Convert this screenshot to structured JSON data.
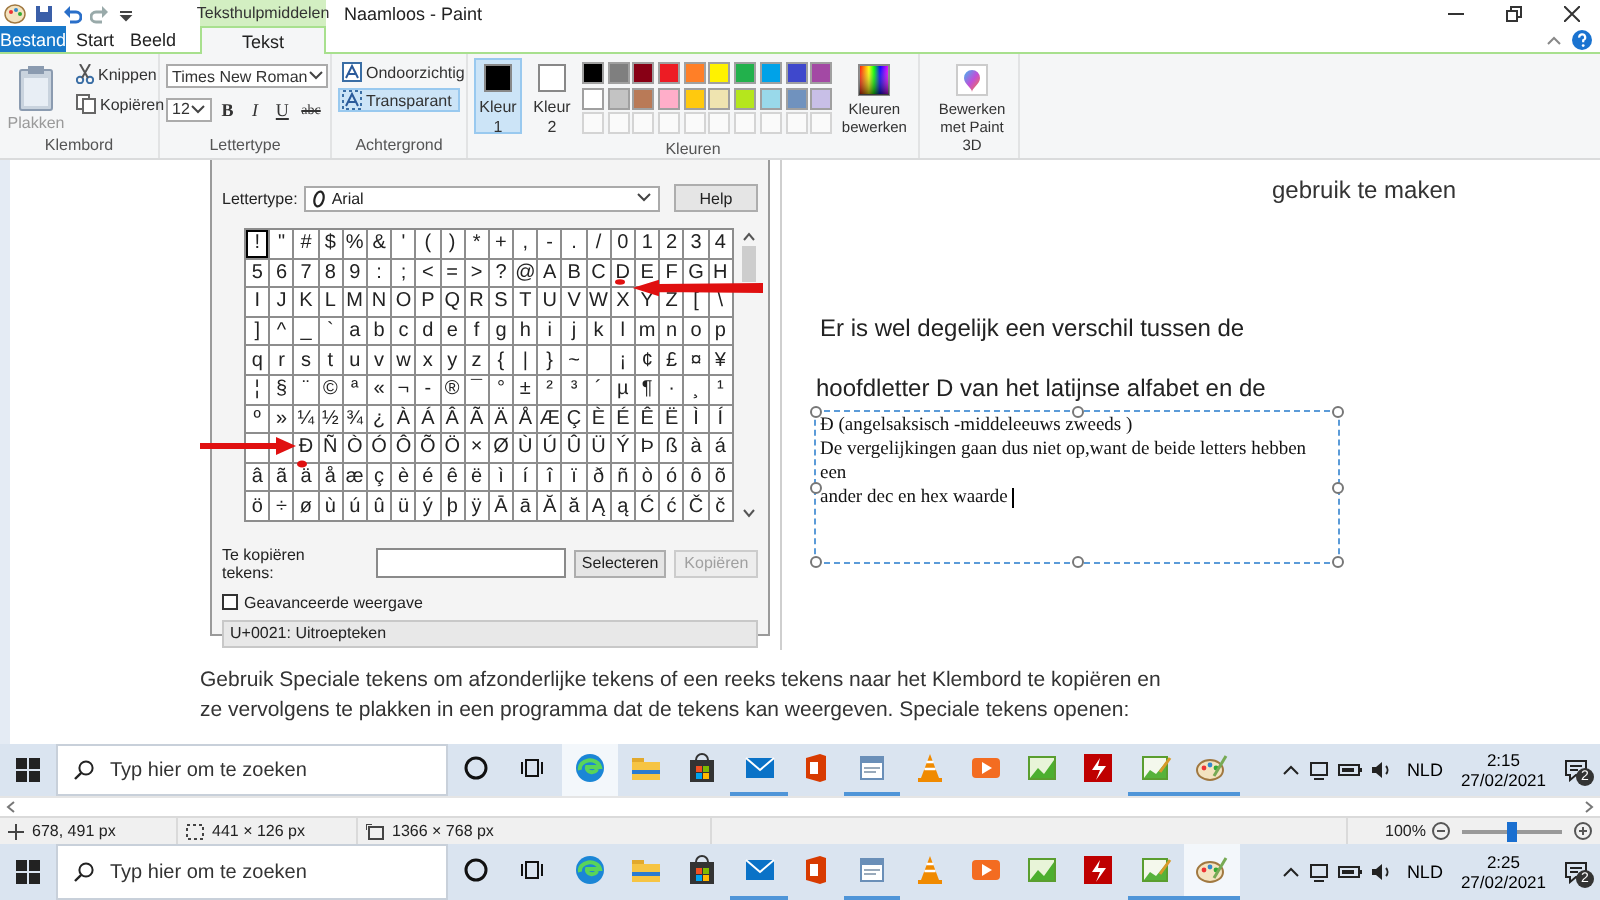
{
  "window": {
    "title": "Naamloos - Paint",
    "context_tab": "Teksthulpmiddelen"
  },
  "tabs": [
    {
      "label": "Bestand",
      "kind": "file",
      "selected": false
    },
    {
      "label": "Start",
      "kind": "tab",
      "selected": false
    },
    {
      "label": "Beeld",
      "kind": "tab",
      "selected": false
    },
    {
      "label": "Tekst",
      "kind": "tab",
      "selected": true
    }
  ],
  "ribbon": {
    "clipboard": {
      "label": "Klembord",
      "paste": {
        "label": "Plakken",
        "disabled": true
      },
      "cut": "Knippen",
      "copy": "Kopiëren"
    },
    "font": {
      "label": "Lettertype",
      "family": "Times New Roman",
      "size": "12",
      "styles": [
        {
          "label": "B",
          "kind": "bold"
        },
        {
          "label": "I",
          "kind": "italic"
        },
        {
          "label": "U",
          "kind": "underline"
        },
        {
          "label": "abc",
          "kind": "strike"
        }
      ]
    },
    "background": {
      "label": "Achtergrond",
      "options": [
        {
          "label": "Ondoorzichtig",
          "selected": false
        },
        {
          "label": "Transparant",
          "selected": true
        }
      ]
    },
    "colors": {
      "label": "Kleuren",
      "slots": [
        {
          "label": "Kleur 1",
          "color": "#000000",
          "selected": true
        },
        {
          "label": "Kleur 2",
          "color": "#ffffff",
          "selected": false
        }
      ],
      "palette": [
        {
          "color": "#000000"
        },
        {
          "color": "#7f7f7f"
        },
        {
          "color": "#880015"
        },
        {
          "color": "#ed1c24"
        },
        {
          "color": "#ff7f27"
        },
        {
          "color": "#fff200"
        },
        {
          "color": "#22b14c"
        },
        {
          "color": "#00a2e8"
        },
        {
          "color": "#3f48cc"
        },
        {
          "color": "#a349a4"
        },
        {
          "color": "#ffffff"
        },
        {
          "color": "#c3c3c3"
        },
        {
          "color": "#b97a57"
        },
        {
          "color": "#ffaec9"
        },
        {
          "color": "#ffc90e"
        },
        {
          "color": "#efe4b0"
        },
        {
          "color": "#b5e61d"
        },
        {
          "color": "#99d9ea"
        },
        {
          "color": "#7092be"
        },
        {
          "color": "#c8bfe7"
        }
      ],
      "edit": "Kleuren bewerken"
    },
    "paint3d": "Bewerken met Paint 3D"
  },
  "canvas": {
    "char_map": {
      "font_label": "Lettertype:",
      "font": "Arial",
      "help": "Help",
      "rows": [
        [
          {
            "char": "!",
            "selected": true
          },
          {
            "char": "\"",
            "selected": false
          },
          {
            "char": "#",
            "selected": false
          },
          {
            "char": "$",
            "selected": false
          },
          {
            "char": "%",
            "selected": false
          },
          {
            "char": "&",
            "selected": false
          },
          {
            "char": "'",
            "selected": false
          },
          {
            "char": "(",
            "selected": false
          },
          {
            "char": ")",
            "selected": false
          },
          {
            "char": "*",
            "selected": false
          },
          {
            "char": "+",
            "selected": false
          },
          {
            "char": ",",
            "selected": false
          },
          {
            "char": "-",
            "selected": false
          },
          {
            "char": ".",
            "selected": false
          },
          {
            "char": "/",
            "selected": false
          },
          {
            "char": "0",
            "selected": false
          },
          {
            "char": "1",
            "selected": false
          },
          {
            "char": "2",
            "selected": false
          },
          {
            "char": "3",
            "selected": false
          },
          {
            "char": "4",
            "selected": false
          }
        ],
        [
          {
            "char": "5",
            "selected": false
          },
          {
            "char": "6",
            "selected": false
          },
          {
            "char": "7",
            "selected": false
          },
          {
            "char": "8",
            "selected": false
          },
          {
            "char": "9",
            "selected": false
          },
          {
            "char": ":",
            "selected": false
          },
          {
            "char": ";",
            "selected": false
          },
          {
            "char": "<",
            "selected": false
          },
          {
            "char": "=",
            "selected": false
          },
          {
            "char": ">",
            "selected": false
          },
          {
            "char": "?",
            "selected": false
          },
          {
            "char": "@",
            "selected": false
          },
          {
            "char": "A",
            "selected": false
          },
          {
            "char": "B",
            "selected": false
          },
          {
            "char": "C",
            "selected": false
          },
          {
            "char": "D",
            "selected": false
          },
          {
            "char": "E",
            "selected": false
          },
          {
            "char": "F",
            "selected": false
          },
          {
            "char": "G",
            "selected": false
          },
          {
            "char": "H",
            "selected": false
          }
        ],
        [
          {
            "char": "I",
            "selected": false
          },
          {
            "char": "J",
            "selected": false
          },
          {
            "char": "K",
            "selected": false
          },
          {
            "char": "L",
            "selected": false
          },
          {
            "char": "M",
            "selected": false
          },
          {
            "char": "N",
            "selected": false
          },
          {
            "char": "O",
            "selected": false
          },
          {
            "char": "P",
            "selected": false
          },
          {
            "char": "Q",
            "selected": false
          },
          {
            "char": "R",
            "selected": false
          },
          {
            "char": "S",
            "selected": false
          },
          {
            "char": "T",
            "selected": false
          },
          {
            "char": "U",
            "selected": false
          },
          {
            "char": "V",
            "selected": false
          },
          {
            "char": "W",
            "selected": false
          },
          {
            "char": "X",
            "selected": false
          },
          {
            "char": "Y",
            "selected": false
          },
          {
            "char": "Z",
            "selected": false
          },
          {
            "char": "[",
            "selected": false
          },
          {
            "char": "\\",
            "selected": false
          }
        ],
        [
          {
            "char": "]",
            "selected": false
          },
          {
            "char": "^",
            "selected": false
          },
          {
            "char": "_",
            "selected": false
          },
          {
            "char": "`",
            "selected": false
          },
          {
            "char": "a",
            "selected": false
          },
          {
            "char": "b",
            "selected": false
          },
          {
            "char": "c",
            "selected": false
          },
          {
            "char": "d",
            "selected": false
          },
          {
            "char": "e",
            "selected": false
          },
          {
            "char": "f",
            "selected": false
          },
          {
            "char": "g",
            "selected": false
          },
          {
            "char": "h",
            "selected": false
          },
          {
            "char": "i",
            "selected": false
          },
          {
            "char": "j",
            "selected": false
          },
          {
            "char": "k",
            "selected": false
          },
          {
            "char": "l",
            "selected": false
          },
          {
            "char": "m",
            "selected": false
          },
          {
            "char": "n",
            "selected": false
          },
          {
            "char": "o",
            "selected": false
          },
          {
            "char": "p",
            "selected": false
          }
        ],
        [
          {
            "char": "q",
            "selected": false
          },
          {
            "char": "r",
            "selected": false
          },
          {
            "char": "s",
            "selected": false
          },
          {
            "char": "t",
            "selected": false
          },
          {
            "char": "u",
            "selected": false
          },
          {
            "char": "v",
            "selected": false
          },
          {
            "char": "w",
            "selected": false
          },
          {
            "char": "x",
            "selected": false
          },
          {
            "char": "y",
            "selected": false
          },
          {
            "char": "z",
            "selected": false
          },
          {
            "char": "{",
            "selected": false
          },
          {
            "char": "|",
            "selected": false
          },
          {
            "char": "}",
            "selected": false
          },
          {
            "char": "~",
            "selected": false
          },
          {
            "selected": false
          },
          {
            "char": "¡",
            "selected": false
          },
          {
            "char": "¢",
            "selected": false
          },
          {
            "char": "£",
            "selected": false
          },
          {
            "char": "¤",
            "selected": false
          },
          {
            "char": "¥",
            "selected": false
          }
        ],
        [
          {
            "char": "¦",
            "selected": false
          },
          {
            "char": "§",
            "selected": false
          },
          {
            "char": "¨",
            "selected": false
          },
          {
            "char": "©",
            "selected": false
          },
          {
            "char": "ª",
            "selected": false
          },
          {
            "char": "«",
            "selected": false
          },
          {
            "char": "¬",
            "selected": false
          },
          {
            "char": "-",
            "selected": false
          },
          {
            "char": "®",
            "selected": false
          },
          {
            "char": "¯",
            "selected": false
          },
          {
            "char": "°",
            "selected": false
          },
          {
            "char": "±",
            "selected": false
          },
          {
            "char": "²",
            "selected": false
          },
          {
            "char": "³",
            "selected": false
          },
          {
            "char": "´",
            "selected": false
          },
          {
            "char": "µ",
            "selected": false
          },
          {
            "char": "¶",
            "selected": false
          },
          {
            "char": "·",
            "selected": false
          },
          {
            "char": "¸",
            "selected": false
          },
          {
            "char": "¹",
            "selected": false
          }
        ],
        [
          {
            "char": "º",
            "selected": false
          },
          {
            "char": "»",
            "selected": false
          },
          {
            "char": "¼",
            "selected": false
          },
          {
            "char": "½",
            "selected": false
          },
          {
            "char": "¾",
            "selected": false
          },
          {
            "char": "¿",
            "selected": false
          },
          {
            "char": "À",
            "selected": false
          },
          {
            "char": "Á",
            "selected": false
          },
          {
            "char": "Â",
            "selected": false
          },
          {
            "char": "Ã",
            "selected": false
          },
          {
            "char": "Ä",
            "selected": false
          },
          {
            "char": "Å",
            "selected": false
          },
          {
            "char": "Æ",
            "selected": false
          },
          {
            "char": "Ç",
            "selected": false
          },
          {
            "char": "È",
            "selected": false
          },
          {
            "char": "É",
            "selected": false
          },
          {
            "char": "Ê",
            "selected": false
          },
          {
            "char": "Ë",
            "selected": false
          },
          {
            "char": "Ì",
            "selected": false
          },
          {
            "char": "Í",
            "selected": false
          }
        ],
        [
          {
            "selected": false
          },
          {
            "selected": false
          },
          {
            "char": "Ð",
            "selected": false
          },
          {
            "char": "Ñ",
            "selected": false
          },
          {
            "char": "Ò",
            "selected": false
          },
          {
            "char": "Ó",
            "selected": false
          },
          {
            "char": "Ô",
            "selected": false
          },
          {
            "char": "Õ",
            "selected": false
          },
          {
            "char": "Ö",
            "selected": false
          },
          {
            "char": "×",
            "selected": false
          },
          {
            "char": "Ø",
            "selected": false
          },
          {
            "char": "Ù",
            "selected": false
          },
          {
            "char": "Ú",
            "selected": false
          },
          {
            "char": "Û",
            "selected": false
          },
          {
            "char": "Ü",
            "selected": false
          },
          {
            "char": "Ý",
            "selected": false
          },
          {
            "char": "Þ",
            "selected": false
          },
          {
            "char": "ß",
            "selected": false
          },
          {
            "char": "à",
            "selected": false
          },
          {
            "char": "á",
            "selected": false
          }
        ],
        [
          {
            "char": "â",
            "selected": false
          },
          {
            "char": "ã",
            "selected": false
          },
          {
            "char": "ä",
            "selected": false
          },
          {
            "char": "å",
            "selected": false
          },
          {
            "char": "æ",
            "selected": false
          },
          {
            "char": "ç",
            "selected": false
          },
          {
            "char": "è",
            "selected": false
          },
          {
            "char": "é",
            "selected": false
          },
          {
            "char": "ê",
            "selected": false
          },
          {
            "char": "ë",
            "selected": false
          },
          {
            "char": "ì",
            "selected": false
          },
          {
            "char": "í",
            "selected": false
          },
          {
            "char": "î",
            "selected": false
          },
          {
            "char": "ï",
            "selected": false
          },
          {
            "char": "ð",
            "selected": false
          },
          {
            "char": "ñ",
            "selected": false
          },
          {
            "char": "ò",
            "selected": false
          },
          {
            "char": "ó",
            "selected": false
          },
          {
            "char": "ô",
            "selected": false
          },
          {
            "char": "õ",
            "selected": false
          }
        ],
        [
          {
            "char": "ö",
            "selected": false
          },
          {
            "char": "÷",
            "selected": false
          },
          {
            "char": "ø",
            "selected": false
          },
          {
            "char": "ù",
            "selected": false
          },
          {
            "char": "ú",
            "selected": false
          },
          {
            "char": "û",
            "selected": false
          },
          {
            "char": "ü",
            "selected": false
          },
          {
            "char": "ý",
            "selected": false
          },
          {
            "char": "þ",
            "selected": false
          },
          {
            "char": "ÿ",
            "selected": false
          },
          {
            "char": "Ā",
            "selected": false
          },
          {
            "char": "ā",
            "selected": false
          },
          {
            "char": "Ă",
            "selected": false
          },
          {
            "char": "ă",
            "selected": false
          },
          {
            "char": "Ą",
            "selected": false
          },
          {
            "char": "ą",
            "selected": false
          },
          {
            "char": "Ć",
            "selected": false
          },
          {
            "char": "ć",
            "selected": false
          },
          {
            "char": "Č",
            "selected": false
          },
          {
            "char": "č",
            "selected": false
          }
        ]
      ],
      "copy_label": "Te kopiëren tekens:",
      "select": "Selecteren",
      "copy": {
        "label": "Kopiëren",
        "disabled": true
      },
      "advanced": {
        "label": "Geavanceerde weergave",
        "checked": false
      },
      "status": "U+0021: Uitroepteken"
    },
    "side_text": "gebruik te maken",
    "lines": [
      "Er is wel degelijk een verschil tussen de",
      "hoofdletter D van het latijnse alfabet en de"
    ],
    "text_box": {
      "lines": [
        "Ð (angelsaksisch -middeleeuws zweeds )",
        "De vergelijkingen gaan dus niet op,want de beide letters hebben een",
        "ander dec en hex waarde"
      ]
    },
    "paragraph": "Gebruik Speciale tekens om afzonderlijke tekens of een reeks tekens naar het Klembord te kopiëren en ze vervolgens te plakken in een programma dat de tekens kan weergeven. Speciale tekens openen:",
    "inner_taskbar": {
      "search_placeholder": "Typ hier om te zoeken",
      "apps": [
        {
          "kind": "browser",
          "running": false,
          "active": true
        },
        {
          "kind": "folder",
          "running": false,
          "active": false
        },
        {
          "kind": "store",
          "running": false,
          "active": false
        },
        {
          "kind": "mail",
          "running": true,
          "active": false
        },
        {
          "kind": "office",
          "running": false,
          "active": false
        },
        {
          "kind": "document",
          "running": true,
          "active": false
        },
        {
          "kind": "cone",
          "running": false,
          "active": false
        },
        {
          "kind": "media",
          "running": false,
          "active": false
        },
        {
          "kind": "chart",
          "running": false,
          "active": false
        },
        {
          "kind": "ftp",
          "running": false,
          "active": false
        },
        {
          "kind": "chart-edit",
          "running": true,
          "active": false
        },
        {
          "kind": "paint",
          "running": true,
          "active": false
        }
      ],
      "language": "NLD",
      "time": "2:15",
      "date": "27/02/2021",
      "notifications": "2"
    }
  },
  "status_bar": {
    "cursor": "678, 491 px",
    "selection": "441 × 126 px",
    "canvas_size": "1366 × 768 px",
    "zoom": "100%",
    "zoom_slider": {
      "level": 0.5
    }
  },
  "taskbar": {
    "search_placeholder": "Typ hier om te zoeken",
    "apps": [
      {
        "kind": "browser",
        "running": false,
        "active": false
      },
      {
        "kind": "folder",
        "running": false,
        "active": false
      },
      {
        "kind": "store",
        "running": false,
        "active": false
      },
      {
        "kind": "mail",
        "running": true,
        "active": false
      },
      {
        "kind": "office",
        "running": false,
        "active": false
      },
      {
        "kind": "document",
        "running": true,
        "active": false
      },
      {
        "kind": "cone",
        "running": false,
        "active": false
      },
      {
        "kind": "media",
        "running": false,
        "active": false
      },
      {
        "kind": "chart",
        "running": false,
        "active": false
      },
      {
        "kind": "ftp",
        "running": false,
        "active": false
      },
      {
        "kind": "chart-edit",
        "running": true,
        "active": false
      },
      {
        "kind": "paint",
        "running": true,
        "active": true
      }
    ],
    "language": "NLD",
    "time": "2:25",
    "date": "27/02/2021",
    "notifications": "2"
  }
}
